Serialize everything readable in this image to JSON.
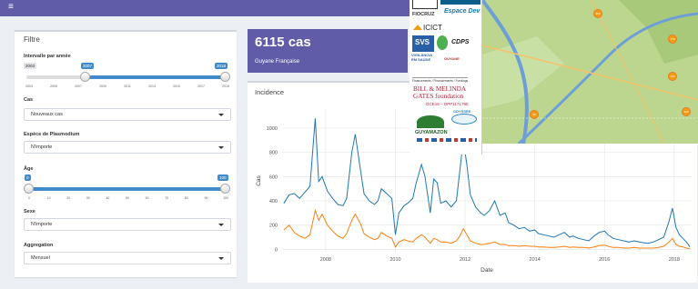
{
  "topbar": {
    "menu_icon": "hamburger-icon",
    "color": "#605ca8"
  },
  "filter": {
    "title": "Filtre",
    "year_slider": {
      "label": "Intervalle par année",
      "min": "2003",
      "max_label": "2018",
      "selected_from": "2007",
      "selected_to": "2018",
      "ticks": [
        "2003",
        "2005",
        "2007",
        "2009",
        "2011",
        "2013",
        "2015",
        "2017",
        "2018"
      ]
    },
    "cas": {
      "label": "Cas",
      "value": "Nouveaux cas"
    },
    "espece": {
      "label": "Espèce de Plasmodium",
      "value": "N'importe"
    },
    "age_slider": {
      "label": "Âge",
      "selected_from": "0",
      "selected_to": "100",
      "ticks": [
        "0",
        "10",
        "20",
        "30",
        "40",
        "50",
        "60",
        "70",
        "80",
        "90",
        "100"
      ]
    },
    "sexe": {
      "label": "Sexe",
      "value": "N'importe"
    },
    "aggregation": {
      "label": "Aggregation",
      "value": "Mensuel"
    }
  },
  "valuebox": {
    "value": "6115 cas",
    "caption": "Guyane Française"
  },
  "incidence": {
    "title": "Incidence"
  },
  "logos": {
    "fiocruz": "FIOCRUZ",
    "espace_dev": "Espace Dev",
    "icict": "ICICT",
    "svs": "SVS",
    "cdps": "CDPS",
    "vigilancia": "VIGILÂNCIA EM SAÚDE",
    "guyane": "GUYANE",
    "financements": "Financements / Financiements / Fundings",
    "gates": "BILL & MELINDA GATES foundation",
    "gates_grant": "GCE18 – OPP1171795",
    "odysse": "ODYSSEE",
    "guyamazon": "GUYAMAZON"
  },
  "map": {
    "markers": [
      "360",
      "176",
      "140",
      "69",
      "100"
    ]
  },
  "chart_data": {
    "type": "line",
    "xlabel": "Date",
    "ylabel": "Cas",
    "xlim": [
      2006.75,
      2018.5
    ],
    "ylim": [
      -20,
      1150
    ],
    "x_ticks": [
      "2008",
      "2010",
      "2012",
      "2014",
      "2016",
      "2018"
    ],
    "y_ticks": [
      "0",
      "200",
      "400",
      "600",
      "800",
      "1000"
    ],
    "grid": true,
    "legend": "none",
    "series": [
      {
        "color": "#1f77b4",
        "points": [
          [
            2006.8,
            380
          ],
          [
            2006.95,
            450
          ],
          [
            2007.1,
            460
          ],
          [
            2007.25,
            420
          ],
          [
            2007.4,
            470
          ],
          [
            2007.55,
            520
          ],
          [
            2007.7,
            1080
          ],
          [
            2007.8,
            560
          ],
          [
            2007.9,
            600
          ],
          [
            2008.05,
            480
          ],
          [
            2008.2,
            420
          ],
          [
            2008.35,
            370
          ],
          [
            2008.5,
            360
          ],
          [
            2008.6,
            420
          ],
          [
            2008.75,
            800
          ],
          [
            2008.85,
            950
          ],
          [
            2009.0,
            650
          ],
          [
            2009.1,
            460
          ],
          [
            2009.25,
            400
          ],
          [
            2009.4,
            370
          ],
          [
            2009.5,
            400
          ],
          [
            2009.6,
            500
          ],
          [
            2009.75,
            460
          ],
          [
            2009.9,
            420
          ],
          [
            2010.0,
            120
          ],
          [
            2010.1,
            300
          ],
          [
            2010.25,
            360
          ],
          [
            2010.35,
            380
          ],
          [
            2010.5,
            420
          ],
          [
            2010.6,
            550
          ],
          [
            2010.75,
            700
          ],
          [
            2010.85,
            600
          ],
          [
            2011.0,
            300
          ],
          [
            2011.1,
            580
          ],
          [
            2011.2,
            550
          ],
          [
            2011.3,
            380
          ],
          [
            2011.45,
            400
          ],
          [
            2011.6,
            350
          ],
          [
            2011.75,
            400
          ],
          [
            2011.85,
            650
          ],
          [
            2011.95,
            900
          ],
          [
            2012.05,
            700
          ],
          [
            2012.15,
            450
          ],
          [
            2012.3,
            350
          ],
          [
            2012.45,
            300
          ],
          [
            2012.55,
            280
          ],
          [
            2012.7,
            320
          ],
          [
            2012.85,
            400
          ],
          [
            2013.0,
            280
          ],
          [
            2013.15,
            300
          ],
          [
            2013.25,
            220
          ],
          [
            2013.4,
            200
          ],
          [
            2013.55,
            170
          ],
          [
            2013.7,
            180
          ],
          [
            2013.85,
            150
          ],
          [
            2014.0,
            160
          ],
          [
            2014.1,
            130
          ],
          [
            2014.25,
            120
          ],
          [
            2014.4,
            110
          ],
          [
            2014.55,
            100
          ],
          [
            2014.7,
            120
          ],
          [
            2014.85,
            140
          ],
          [
            2015.0,
            100
          ],
          [
            2015.1,
            110
          ],
          [
            2015.25,
            90
          ],
          [
            2015.4,
            80
          ],
          [
            2015.55,
            70
          ],
          [
            2015.7,
            110
          ],
          [
            2015.85,
            140
          ],
          [
            2016.0,
            150
          ],
          [
            2016.1,
            120
          ],
          [
            2016.25,
            90
          ],
          [
            2016.4,
            80
          ],
          [
            2016.55,
            70
          ],
          [
            2016.7,
            60
          ],
          [
            2016.85,
            70
          ],
          [
            2017.0,
            60
          ],
          [
            2017.1,
            55
          ],
          [
            2017.25,
            50
          ],
          [
            2017.4,
            60
          ],
          [
            2017.55,
            80
          ],
          [
            2017.7,
            100
          ],
          [
            2017.85,
            230
          ],
          [
            2017.95,
            340
          ],
          [
            2018.05,
            180
          ],
          [
            2018.15,
            120
          ],
          [
            2018.25,
            90
          ],
          [
            2018.35,
            60
          ],
          [
            2018.45,
            20
          ]
        ]
      },
      {
        "color": "#ff7f0e",
        "points": [
          [
            2006.8,
            160
          ],
          [
            2006.95,
            200
          ],
          [
            2007.1,
            140
          ],
          [
            2007.25,
            110
          ],
          [
            2007.4,
            90
          ],
          [
            2007.55,
            120
          ],
          [
            2007.7,
            320
          ],
          [
            2007.8,
            240
          ],
          [
            2007.9,
            290
          ],
          [
            2008.05,
            200
          ],
          [
            2008.2,
            150
          ],
          [
            2008.35,
            110
          ],
          [
            2008.5,
            90
          ],
          [
            2008.6,
            130
          ],
          [
            2008.75,
            240
          ],
          [
            2008.85,
            290
          ],
          [
            2009.0,
            210
          ],
          [
            2009.1,
            130
          ],
          [
            2009.25,
            100
          ],
          [
            2009.4,
            80
          ],
          [
            2009.5,
            90
          ],
          [
            2009.6,
            140
          ],
          [
            2009.75,
            110
          ],
          [
            2009.9,
            90
          ],
          [
            2010.0,
            20
          ],
          [
            2010.1,
            60
          ],
          [
            2010.25,
            80
          ],
          [
            2010.35,
            70
          ],
          [
            2010.5,
            60
          ],
          [
            2010.6,
            90
          ],
          [
            2010.75,
            120
          ],
          [
            2010.85,
            100
          ],
          [
            2011.0,
            50
          ],
          [
            2011.1,
            90
          ],
          [
            2011.2,
            80
          ],
          [
            2011.3,
            60
          ],
          [
            2011.45,
            60
          ],
          [
            2011.6,
            50
          ],
          [
            2011.75,
            70
          ],
          [
            2011.85,
            110
          ],
          [
            2011.95,
            170
          ],
          [
            2012.05,
            120
          ],
          [
            2012.15,
            70
          ],
          [
            2012.3,
            50
          ],
          [
            2012.45,
            40
          ],
          [
            2012.55,
            40
          ],
          [
            2012.7,
            50
          ],
          [
            2012.85,
            60
          ],
          [
            2013.0,
            40
          ],
          [
            2013.15,
            40
          ],
          [
            2013.25,
            30
          ],
          [
            2013.4,
            30
          ],
          [
            2013.55,
            25
          ],
          [
            2013.7,
            30
          ],
          [
            2013.85,
            25
          ],
          [
            2014.0,
            25
          ],
          [
            2014.1,
            20
          ],
          [
            2014.25,
            20
          ],
          [
            2014.4,
            15
          ],
          [
            2014.55,
            15
          ],
          [
            2014.7,
            20
          ],
          [
            2014.85,
            25
          ],
          [
            2015.0,
            15
          ],
          [
            2015.1,
            20
          ],
          [
            2015.25,
            15
          ],
          [
            2015.4,
            15
          ],
          [
            2015.55,
            10
          ],
          [
            2015.7,
            20
          ],
          [
            2015.85,
            30
          ],
          [
            2016.0,
            35
          ],
          [
            2016.1,
            25
          ],
          [
            2016.25,
            15
          ],
          [
            2016.4,
            15
          ],
          [
            2016.55,
            10
          ],
          [
            2016.7,
            10
          ],
          [
            2016.85,
            15
          ],
          [
            2017.0,
            10
          ],
          [
            2017.1,
            10
          ],
          [
            2017.25,
            10
          ],
          [
            2017.4,
            10
          ],
          [
            2017.55,
            15
          ],
          [
            2017.7,
            25
          ],
          [
            2017.85,
            60
          ],
          [
            2017.95,
            90
          ],
          [
            2018.05,
            40
          ],
          [
            2018.15,
            25
          ],
          [
            2018.25,
            20
          ],
          [
            2018.35,
            10
          ],
          [
            2018.45,
            5
          ]
        ]
      }
    ]
  }
}
